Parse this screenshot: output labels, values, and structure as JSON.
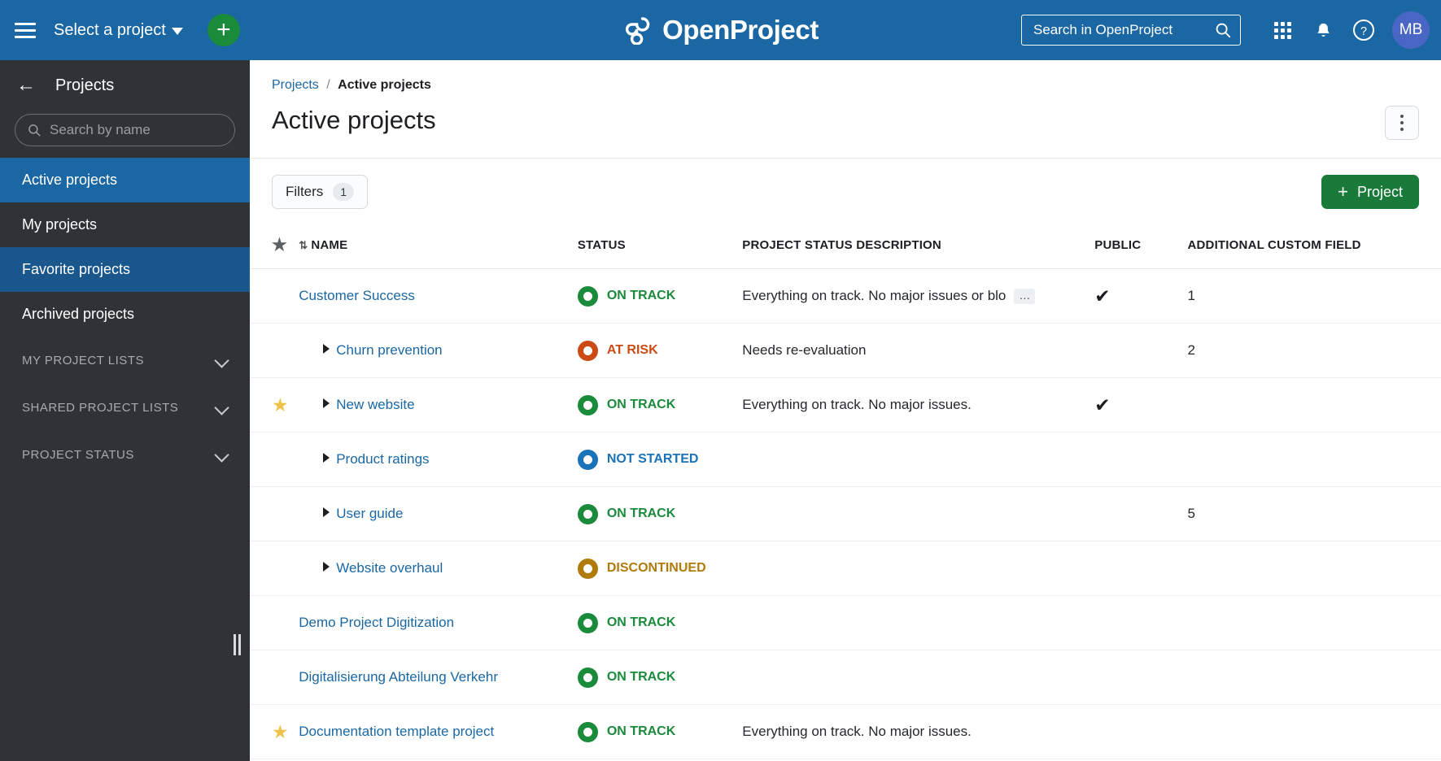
{
  "topbar": {
    "menu_icon": "hamburger-icon",
    "project_select_label": "Select a project",
    "add_label": "+",
    "logo_text": "OpenProject",
    "search_placeholder": "Search in OpenProject",
    "modules_icon": "grid-icon",
    "notifications_icon": "bell-icon",
    "help_icon": "help-icon",
    "avatar_initials": "MB",
    "accent_blue": "#1A67A3",
    "accent_green": "#1A8A3B"
  },
  "sidebar": {
    "back_icon": "arrow-left-icon",
    "title": "Projects",
    "search_placeholder": "Search by name",
    "items": [
      {
        "label": "Active projects",
        "state": "active"
      },
      {
        "label": "My projects",
        "state": "normal"
      },
      {
        "label": "Favorite projects",
        "state": "hover"
      },
      {
        "label": "Archived projects",
        "state": "normal"
      }
    ],
    "sections": [
      {
        "label": "MY PROJECT LISTS"
      },
      {
        "label": "SHARED PROJECT LISTS"
      },
      {
        "label": "PROJECT STATUS"
      }
    ]
  },
  "main": {
    "breadcrumb": {
      "root": "Projects",
      "separator": "/",
      "current": "Active projects"
    },
    "page_title": "Active projects",
    "more_menu_icon": "kebab-menu-icon",
    "filters_label": "Filters",
    "filters_count": "1",
    "new_project_label": "Project",
    "new_project_plus": "+"
  },
  "table": {
    "columns": {
      "favorite": "",
      "name": "NAME",
      "status": "STATUS",
      "description": "PROJECT STATUS DESCRIPTION",
      "public": "PUBLIC",
      "custom_field": "ADDITIONAL CUSTOM FIELD"
    },
    "status_colors": {
      "ON TRACK": "#1A8A3B",
      "AT RISK": "#CC4A13",
      "NOT STARTED": "#1A72B8",
      "DISCONTINUED": "#B07B0A"
    },
    "rows": [
      {
        "favorite": false,
        "indent": 0,
        "name": "Customer Success",
        "status": "ON TRACK",
        "description": "Everything on track. No major issues or blo",
        "truncated": true,
        "more": "…",
        "public": true,
        "custom_field": "1"
      },
      {
        "favorite": false,
        "indent": 1,
        "name": "Churn prevention",
        "status": "AT RISK",
        "description": "Needs re-evaluation",
        "truncated": false,
        "public": false,
        "custom_field": "2"
      },
      {
        "favorite": true,
        "indent": 1,
        "name": "New website",
        "status": "ON TRACK",
        "description": "Everything on track. No major issues.",
        "truncated": false,
        "public": true,
        "custom_field": ""
      },
      {
        "favorite": false,
        "indent": 1,
        "name": "Product ratings",
        "status": "NOT STARTED",
        "description": "",
        "truncated": false,
        "public": false,
        "custom_field": ""
      },
      {
        "favorite": false,
        "indent": 1,
        "name": "User guide",
        "status": "ON TRACK",
        "description": "",
        "truncated": false,
        "public": false,
        "custom_field": "5"
      },
      {
        "favorite": false,
        "indent": 1,
        "name": "Website overhaul",
        "status": "DISCONTINUED",
        "description": "",
        "truncated": false,
        "public": false,
        "custom_field": ""
      },
      {
        "favorite": false,
        "indent": 0,
        "name": "Demo Project Digitization",
        "status": "ON TRACK",
        "description": "",
        "truncated": false,
        "public": false,
        "custom_field": ""
      },
      {
        "favorite": false,
        "indent": 0,
        "name": "Digitalisierung Abteilung Verkehr",
        "status": "ON TRACK",
        "description": "",
        "truncated": false,
        "public": false,
        "custom_field": ""
      },
      {
        "favorite": true,
        "indent": 0,
        "name": "Documentation template project",
        "status": "ON TRACK",
        "description": "Everything on track. No major issues.",
        "truncated": false,
        "public": false,
        "custom_field": ""
      }
    ]
  }
}
